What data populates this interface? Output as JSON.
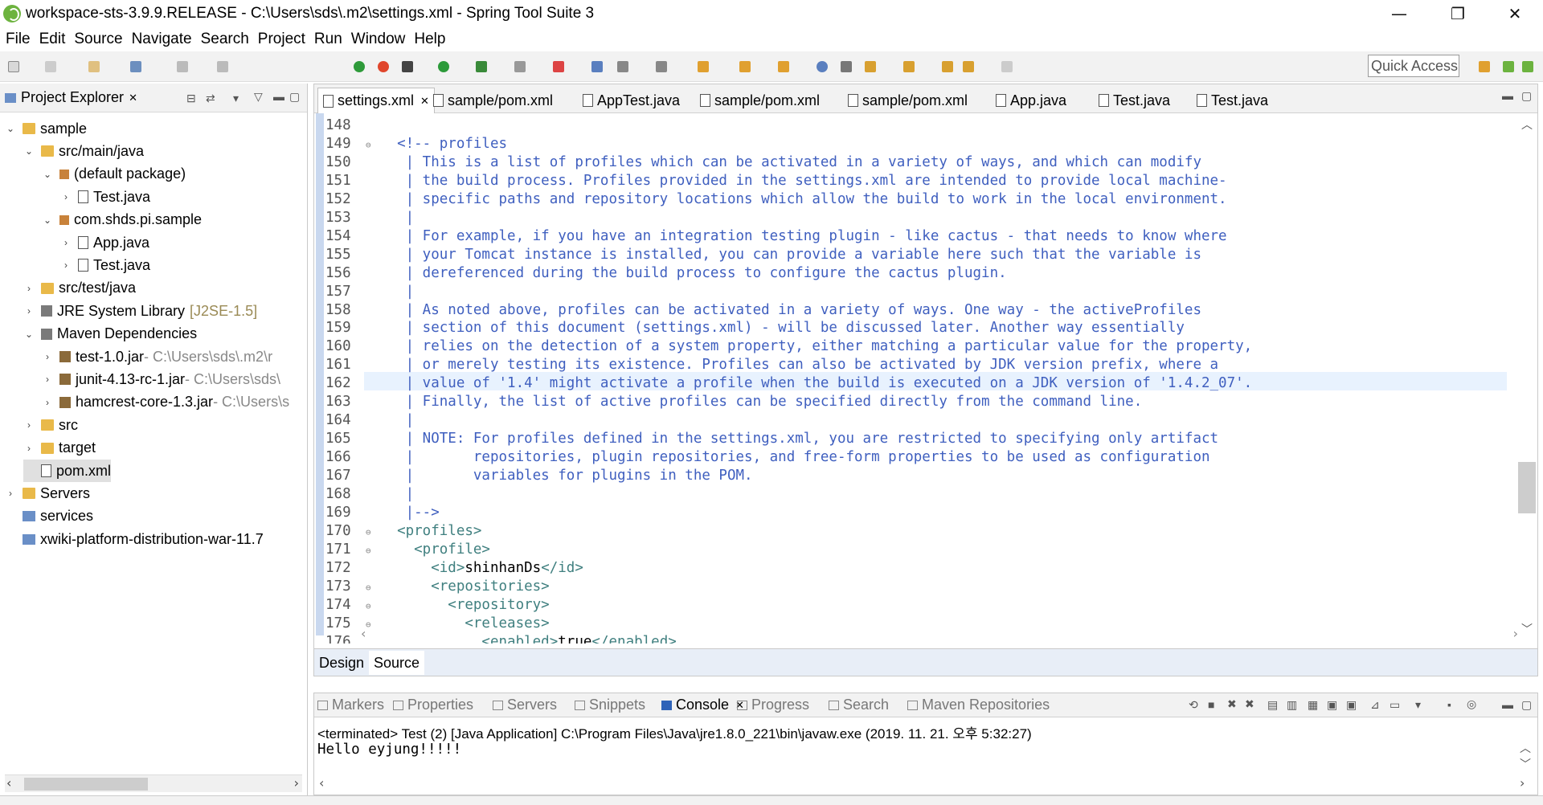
{
  "window": {
    "title": "workspace-sts-3.9.9.RELEASE - C:\\Users\\sds\\.m2\\settings.xml - Spring Tool Suite 3",
    "minimize": "—",
    "restore": "❐",
    "close": "✕"
  },
  "menu": [
    "File",
    "Edit",
    "Source",
    "Navigate",
    "Search",
    "Project",
    "Run",
    "Window",
    "Help"
  ],
  "toolbar": {
    "quick_access": "Quick Access"
  },
  "project_explorer": {
    "title": "Project Explorer",
    "tree": [
      {
        "label": "sample",
        "icon": "project-folder-icon",
        "twisty": "⌄",
        "level": 0
      },
      {
        "label": "src/main/java",
        "icon": "source-folder-icon",
        "twisty": "⌄",
        "level": 1
      },
      {
        "label": "(default package)",
        "icon": "package-icon",
        "twisty": "⌄",
        "level": 2
      },
      {
        "label": "Test.java",
        "icon": "java-file-icon",
        "twisty": "›",
        "level": 3
      },
      {
        "label": "com.shds.pi.sample",
        "icon": "package-icon",
        "twisty": "⌄",
        "level": 2
      },
      {
        "label": "App.java",
        "icon": "java-file-icon",
        "twisty": "›",
        "level": 3
      },
      {
        "label": "Test.java",
        "icon": "java-file-icon",
        "twisty": "›",
        "level": 3
      },
      {
        "label": "src/test/java",
        "icon": "source-folder-icon",
        "twisty": "›",
        "level": 1
      },
      {
        "label": "JRE System Library",
        "extra": "[J2SE-1.5]",
        "icon": "library-icon",
        "twisty": "›",
        "level": 1
      },
      {
        "label": "Maven Dependencies",
        "icon": "library-icon",
        "twisty": "⌄",
        "level": 1
      },
      {
        "label": "test-1.0.jar",
        "extra": " - C:\\Users\\sds\\.m2\\r",
        "icon": "jar-icon",
        "twisty": "›",
        "level": 2
      },
      {
        "label": "junit-4.13-rc-1.jar",
        "extra": " - C:\\Users\\sds\\",
        "icon": "jar-icon",
        "twisty": "›",
        "level": 2
      },
      {
        "label": "hamcrest-core-1.3.jar",
        "extra": " - C:\\Users\\s",
        "icon": "jar-icon",
        "twisty": "›",
        "level": 2
      },
      {
        "label": "src",
        "icon": "folder-icon",
        "twisty": "›",
        "level": 1
      },
      {
        "label": "target",
        "icon": "folder-icon",
        "twisty": "›",
        "level": 1
      },
      {
        "label": "pom.xml",
        "icon": "xml-file-icon",
        "twisty": "",
        "level": 1
      },
      {
        "label": "Servers",
        "icon": "folder-icon",
        "twisty": "›",
        "level": 0
      },
      {
        "label": "services",
        "icon": "project-icon",
        "twisty": "",
        "level": 0
      },
      {
        "label": "xwiki-platform-distribution-war-11.7",
        "icon": "project-icon",
        "twisty": "",
        "level": 0
      }
    ]
  },
  "editor": {
    "tabs": [
      {
        "label": "settings.xml",
        "icon": "xml-file-icon",
        "active": true
      },
      {
        "label": "sample/pom.xml",
        "icon": "xml-file-icon"
      },
      {
        "label": "AppTest.java",
        "icon": "java-file-icon"
      },
      {
        "label": "sample/pom.xml",
        "icon": "xml-file-icon"
      },
      {
        "label": "sample/pom.xml",
        "icon": "xml-file-icon"
      },
      {
        "label": "App.java",
        "icon": "java-file-icon"
      },
      {
        "label": "Test.java",
        "icon": "java-file-icon"
      },
      {
        "label": "Test.java",
        "icon": "java-file-icon"
      }
    ],
    "lines": [
      {
        "n": "148",
        "fold": "",
        "parts": [
          [
            "tx",
            ""
          ]
        ]
      },
      {
        "n": "149",
        "fold": "⊖",
        "parts": [
          [
            "cm",
            "  <!-- profiles"
          ]
        ]
      },
      {
        "n": "150",
        "fold": "",
        "parts": [
          [
            "cm",
            "   | This is a list of profiles which can be activated in a variety of ways, and which can modify"
          ]
        ]
      },
      {
        "n": "151",
        "fold": "",
        "parts": [
          [
            "cm",
            "   | the build process. Profiles provided in the settings.xml are intended to provide local machine-"
          ]
        ]
      },
      {
        "n": "152",
        "fold": "",
        "parts": [
          [
            "cm",
            "   | specific paths and repository locations which allow the build to work in the local environment."
          ]
        ]
      },
      {
        "n": "153",
        "fold": "",
        "parts": [
          [
            "cm",
            "   |"
          ]
        ]
      },
      {
        "n": "154",
        "fold": "",
        "parts": [
          [
            "cm",
            "   | For example, if you have an integration testing plugin - like cactus - that needs to know where"
          ]
        ]
      },
      {
        "n": "155",
        "fold": "",
        "parts": [
          [
            "cm",
            "   | your Tomcat instance is installed, you can provide a variable here such that the variable is"
          ]
        ]
      },
      {
        "n": "156",
        "fold": "",
        "parts": [
          [
            "cm",
            "   | dereferenced during the build process to configure the cactus plugin."
          ]
        ]
      },
      {
        "n": "157",
        "fold": "",
        "parts": [
          [
            "cm",
            "   |"
          ]
        ]
      },
      {
        "n": "158",
        "fold": "",
        "parts": [
          [
            "cm",
            "   | As noted above, profiles can be activated in a variety of ways. One way - the activeProfiles"
          ]
        ]
      },
      {
        "n": "159",
        "fold": "",
        "parts": [
          [
            "cm",
            "   | section of this document (settings.xml) - will be discussed later. Another way essentially"
          ]
        ]
      },
      {
        "n": "160",
        "fold": "",
        "parts": [
          [
            "cm",
            "   | relies on the detection of a system property, either matching a particular value for the property,"
          ]
        ]
      },
      {
        "n": "161",
        "fold": "",
        "parts": [
          [
            "cm",
            "   | or merely testing its existence. Profiles can also be activated by JDK version prefix, where a"
          ]
        ]
      },
      {
        "n": "162",
        "fold": "",
        "parts": [
          [
            "cm",
            "   | value of '1.4' might activate a profile when the build is executed on a JDK version of '1.4.2_07'."
          ]
        ]
      },
      {
        "n": "163",
        "fold": "",
        "parts": [
          [
            "cm",
            "   | Finally, the list of active profiles can be specified directly from the command line."
          ]
        ]
      },
      {
        "n": "164",
        "fold": "",
        "parts": [
          [
            "cm",
            "   |"
          ]
        ]
      },
      {
        "n": "165",
        "fold": "",
        "parts": [
          [
            "cm",
            "   | NOTE: For profiles defined in the settings.xml, you are restricted to specifying only artifact"
          ]
        ]
      },
      {
        "n": "166",
        "fold": "",
        "parts": [
          [
            "cm",
            "   |       repositories, plugin repositories, and free-form properties to be used as configuration"
          ]
        ]
      },
      {
        "n": "167",
        "fold": "",
        "parts": [
          [
            "cm",
            "   |       variables for plugins in the POM."
          ]
        ]
      },
      {
        "n": "168",
        "fold": "",
        "parts": [
          [
            "cm",
            "   |"
          ]
        ]
      },
      {
        "n": "169",
        "fold": "",
        "parts": [
          [
            "cm",
            "   |-->"
          ]
        ]
      },
      {
        "n": "170",
        "fold": "⊖",
        "parts": [
          [
            "tg",
            "  <profiles>"
          ]
        ]
      },
      {
        "n": "171",
        "fold": "⊖",
        "parts": [
          [
            "tg",
            "    <profile>"
          ]
        ]
      },
      {
        "n": "172",
        "fold": "",
        "parts": [
          [
            "tg",
            "      <id>"
          ],
          [
            "tx",
            "shinhanDs"
          ],
          [
            "tg",
            "</id>"
          ]
        ]
      },
      {
        "n": "173",
        "fold": "⊖",
        "parts": [
          [
            "tg",
            "      <repositories>"
          ]
        ]
      },
      {
        "n": "174",
        "fold": "⊖",
        "parts": [
          [
            "tg",
            "        <repository>"
          ]
        ]
      },
      {
        "n": "175",
        "fold": "⊖",
        "parts": [
          [
            "tg",
            "          <releases>"
          ]
        ]
      },
      {
        "n": "176",
        "fold": "",
        "parts": [
          [
            "tg",
            "            <enabled>"
          ],
          [
            "tx",
            "true"
          ],
          [
            "tg",
            "</enabled>"
          ]
        ]
      }
    ],
    "design_tab": "Design",
    "source_tab": "Source"
  },
  "console": {
    "tabs": [
      "Markers",
      "Properties",
      "Servers",
      "Snippets",
      "Console",
      "Progress",
      "Search",
      "Maven Repositories"
    ],
    "terminated": "<terminated> Test (2) [Java Application] C:\\Program Files\\Java\\jre1.8.0_221\\bin\\javaw.exe (2019. 11. 21. 오후 5:32:27)",
    "output": "Hello eyjung!!!!!"
  }
}
